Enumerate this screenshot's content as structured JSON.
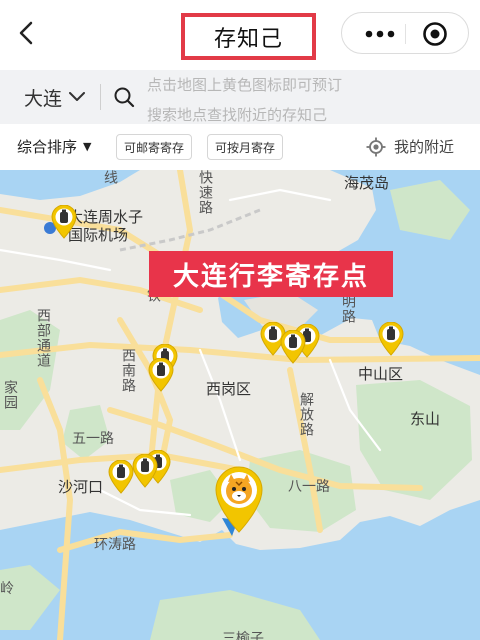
{
  "header": {
    "title": "存知己",
    "back_icon": "chevron-left-icon",
    "more_icon": "more-dots-icon",
    "close_icon": "target-circle-icon"
  },
  "search": {
    "city": "大连",
    "hint_line1": "点击地图上黄色图标即可预订",
    "hint_line2": "搜索地点查找附近的存知己"
  },
  "filters": {
    "sort_label": "综合排序",
    "sort_arrow": "▼",
    "chip1": "可邮寄寄存",
    "chip2": "可按月寄存",
    "nearby_label": "我的附近"
  },
  "map": {
    "banner": "大连行李寄存点",
    "labels": {
      "airport_line1": "大连周水子",
      "airport_line2": "国际机场",
      "haimao": "海茂岛",
      "zhongshan": "中山区",
      "xigang": "西岗区",
      "dongshan": "东山",
      "shahekou": "沙河口",
      "bayi": "八一路",
      "wuyi": "五一路",
      "xinan": "西南路",
      "jiefang": "解放路",
      "xibu": "西部通道",
      "kuaisu": "快速路",
      "ming": "明路",
      "huantao": "环涛路",
      "xian": "线",
      "tie": "铁",
      "jia": "家园",
      "ling": "岭",
      "bottom": "三榆子"
    },
    "colors": {
      "land": "#ecebe6",
      "green": "#cfe6c9",
      "water": "#a9d4f3",
      "road_major": "#f9df9a",
      "banner": "#e8344a",
      "marker": "#f2c500"
    }
  }
}
